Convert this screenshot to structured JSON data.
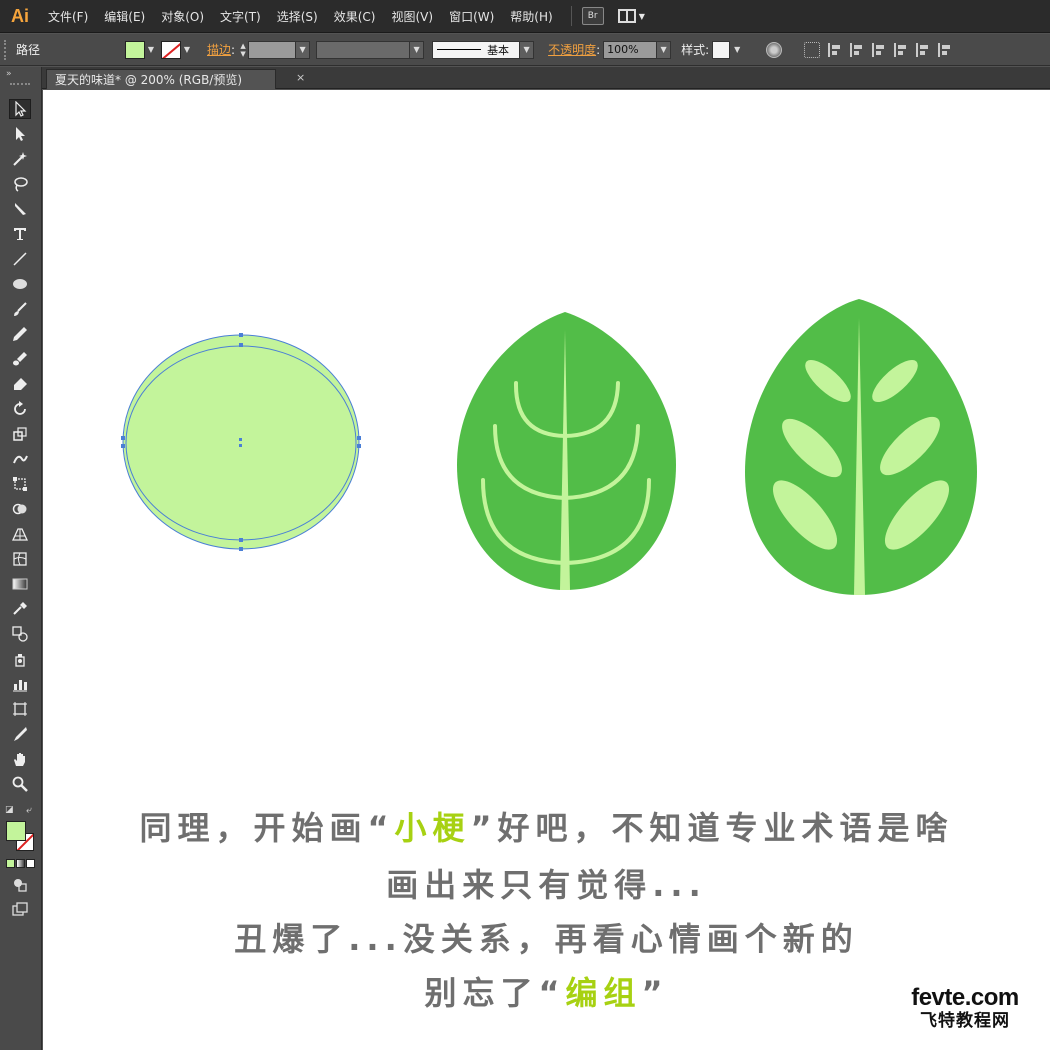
{
  "app": {
    "logo": "Ai"
  },
  "menu": {
    "items": [
      "文件(F)",
      "编辑(E)",
      "对象(O)",
      "文字(T)",
      "选择(S)",
      "效果(C)",
      "视图(V)",
      "窗口(W)",
      "帮助(H)"
    ],
    "bridge_label": "Br"
  },
  "control": {
    "selection_type": "路径",
    "stroke_label": "描边",
    "brush_label": "基本",
    "opacity_label": "不透明度",
    "opacity_value": "100%",
    "style_label": "样式",
    "fill_color": "#c3f49b"
  },
  "document": {
    "tab_title": "夏天的味道* @ 200% (RGB/预览)",
    "close_glyph": "×"
  },
  "tools": [
    "selection-tool",
    "direct-selection-tool",
    "magic-wand-tool",
    "lasso-tool",
    "pen-tool",
    "type-tool",
    "line-tool",
    "ellipse-tool",
    "paintbrush-tool",
    "pencil-tool",
    "blob-brush-tool",
    "eraser-tool",
    "rotate-tool",
    "scale-tool",
    "warp-tool",
    "free-transform-tool",
    "shape-builder-tool",
    "perspective-grid-tool",
    "mesh-tool",
    "gradient-tool",
    "eyedropper-tool",
    "blend-tool",
    "symbol-sprayer-tool",
    "column-graph-tool",
    "artboard-tool",
    "slice-tool",
    "hand-tool",
    "zoom-tool"
  ],
  "caption": {
    "line1_a": "同理，开始画“",
    "line1_hl": "小梗",
    "line1_b": "”好吧，不知道专业术语是啥",
    "line2": "画出来只有觉得...",
    "line3": "丑爆了...没关系，再看心情画个新的",
    "line4_a": "别忘了“",
    "line4_hl": "编组",
    "line4_b": "”"
  },
  "watermark": {
    "line1": "fevte.com",
    "line2": "飞特教程网"
  },
  "colors": {
    "leaf_dark": "#52bd48",
    "leaf_light": "#c3f49b",
    "selection_blue": "#4a7fd6",
    "highlight": "#a7d112",
    "caption_gray": "#6f6f6f"
  }
}
